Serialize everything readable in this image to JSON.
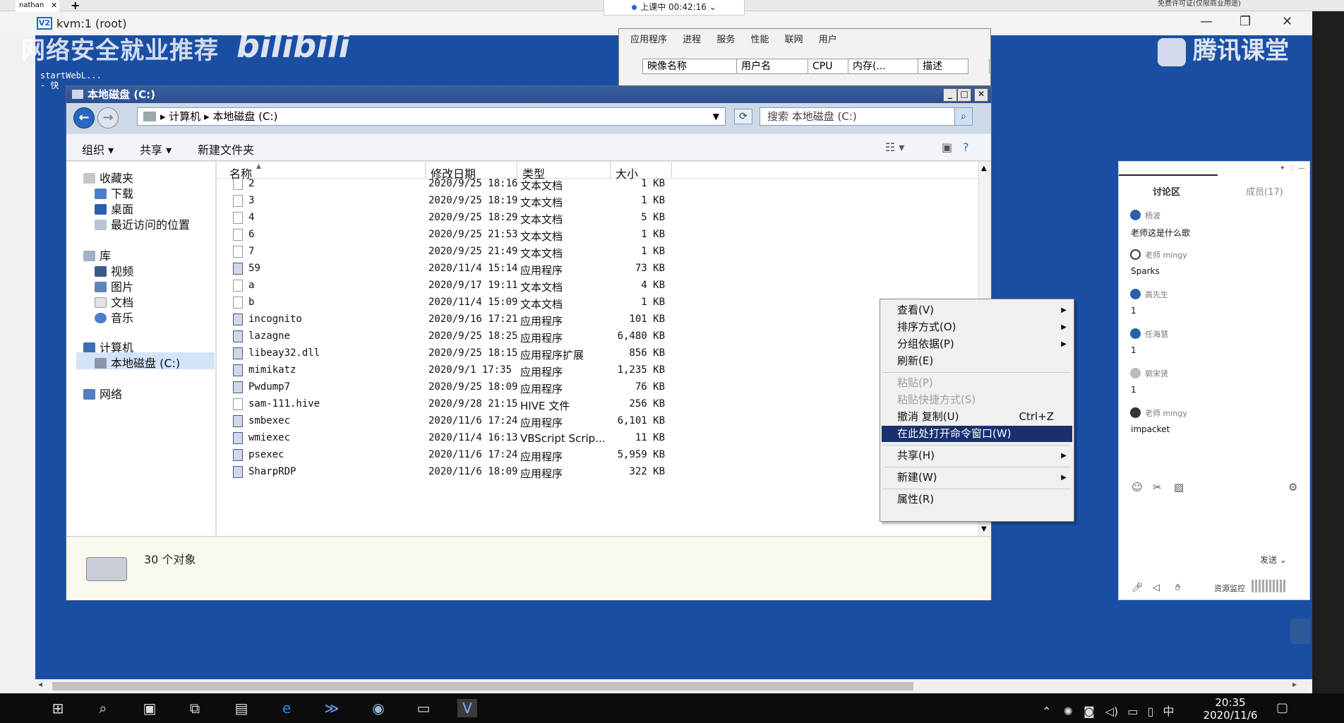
{
  "browser": {
    "tab_label": "nathan",
    "top_notice": "免费许可证(仅限商业用途)"
  },
  "classroom": {
    "status": "上课中 00:42:16",
    "status_chevron": "⌄"
  },
  "vm": {
    "title": "kvm:1 (root)",
    "icon_text": "V2"
  },
  "watermarks": {
    "left": "网络安全就业推荐",
    "bilibili": "bilibili",
    "right": "腾讯课堂"
  },
  "desktop_text": [
    "startWebL...",
    "- 快"
  ],
  "task_manager": {
    "tabs": [
      "应用程序",
      "进程",
      "服务",
      "性能",
      "联网",
      "用户"
    ],
    "columns": [
      "映像名称",
      "用户名",
      "CPU",
      "内存(...",
      "描述"
    ]
  },
  "explorer": {
    "title": "本地磁盘 (C:)",
    "breadcrumb": "▸ 计算机 ▸ 本地磁盘 (C:)",
    "search_placeholder": "搜索 本地磁盘 (C:)",
    "toolbar": {
      "organize": "组织",
      "share": "共享",
      "new_folder": "新建文件夹"
    },
    "sidebar": {
      "favorites": "收藏夹",
      "downloads": "下载",
      "desktop": "桌面",
      "recent": "最近访问的位置",
      "libraries": "库",
      "videos": "视频",
      "pictures": "图片",
      "documents": "文档",
      "music": "音乐",
      "computer": "计算机",
      "local_disk": "本地磁盘 (C:)",
      "network": "网络"
    },
    "columns": {
      "name": "名称",
      "date": "修改日期",
      "type": "类型",
      "size": "大小"
    },
    "files": [
      {
        "name": "2",
        "date": "2020/9/25 18:16",
        "type": "文本文档",
        "size": "1 KB",
        "kind": "txt"
      },
      {
        "name": "3",
        "date": "2020/9/25 18:19",
        "type": "文本文档",
        "size": "1 KB",
        "kind": "txt"
      },
      {
        "name": "4",
        "date": "2020/9/25 18:29",
        "type": "文本文档",
        "size": "5 KB",
        "kind": "txt"
      },
      {
        "name": "6",
        "date": "2020/9/25 21:53",
        "type": "文本文档",
        "size": "1 KB",
        "kind": "txt"
      },
      {
        "name": "7",
        "date": "2020/9/25 21:49",
        "type": "文本文档",
        "size": "1 KB",
        "kind": "txt"
      },
      {
        "name": "59",
        "date": "2020/11/4 15:14",
        "type": "应用程序",
        "size": "73 KB",
        "kind": "exe"
      },
      {
        "name": "a",
        "date": "2020/9/17 19:11",
        "type": "文本文档",
        "size": "4 KB",
        "kind": "txt"
      },
      {
        "name": "b",
        "date": "2020/11/4 15:09",
        "type": "文本文档",
        "size": "1 KB",
        "kind": "txt"
      },
      {
        "name": "incognito",
        "date": "2020/9/16 17:21",
        "type": "应用程序",
        "size": "101 KB",
        "kind": "exe"
      },
      {
        "name": "lazagne",
        "date": "2020/9/25 18:25",
        "type": "应用程序",
        "size": "6,480 KB",
        "kind": "exe"
      },
      {
        "name": "libeay32.dll",
        "date": "2020/9/25 18:15",
        "type": "应用程序扩展",
        "size": "856 KB",
        "kind": "dll"
      },
      {
        "name": "mimikatz",
        "date": "2020/9/1 17:35",
        "type": "应用程序",
        "size": "1,235 KB",
        "kind": "exe"
      },
      {
        "name": "Pwdump7",
        "date": "2020/9/25 18:09",
        "type": "应用程序",
        "size": "76 KB",
        "kind": "exe"
      },
      {
        "name": "sam-111.hive",
        "date": "2020/9/28 21:15",
        "type": "HIVE 文件",
        "size": "256 KB",
        "kind": "txt"
      },
      {
        "name": "smbexec",
        "date": "2020/11/6 17:24",
        "type": "应用程序",
        "size": "6,101 KB",
        "kind": "exe"
      },
      {
        "name": "wmiexec",
        "date": "2020/11/4 16:13",
        "type": "VBScript Scrip...",
        "size": "11 KB",
        "kind": "exe"
      },
      {
        "name": "psexec",
        "date": "2020/11/6 17:24",
        "type": "应用程序",
        "size": "5,959 KB",
        "kind": "exe"
      },
      {
        "name": "SharpRDP",
        "date": "2020/11/6 18:09",
        "type": "应用程序",
        "size": "322 KB",
        "kind": "exe"
      }
    ],
    "status": "30 个对象"
  },
  "context_menu": {
    "items": [
      {
        "label": "查看(V)",
        "submenu": true
      },
      {
        "label": "排序方式(O)",
        "submenu": true
      },
      {
        "label": "分组依据(P)",
        "submenu": true
      },
      {
        "label": "刷新(E)"
      },
      {
        "sep": true
      },
      {
        "label": "粘贴(P)",
        "disabled": true
      },
      {
        "label": "粘贴快捷方式(S)",
        "disabled": true
      },
      {
        "label": "撤消 复制(U)",
        "shortcut": "Ctrl+Z"
      },
      {
        "label": "在此处打开命令窗口(W)",
        "highlighted": true
      },
      {
        "sep": true
      },
      {
        "label": "共享(H)",
        "submenu": true
      },
      {
        "sep": true
      },
      {
        "label": "新建(W)",
        "submenu": true
      },
      {
        "sep": true
      },
      {
        "label": "属性(R)"
      }
    ]
  },
  "discussion": {
    "tab_discussion": "讨论区",
    "tab_members": "成员(17)",
    "messages": [
      {
        "user": "杨波",
        "text": "老师这是什么歌"
      },
      {
        "user": "老师 mingy",
        "text": "Sparks"
      },
      {
        "user": "高先生",
        "text": "1"
      },
      {
        "user": "任海慧",
        "text": "1"
      },
      {
        "user": "郭宋贤",
        "text": "1"
      },
      {
        "user": "老师 mingy",
        "text": "impacket"
      }
    ],
    "send": "发送",
    "monitor": "资源监控"
  },
  "taskbar": {
    "time": "20:35",
    "date": "2020/11/6",
    "ime": "中"
  }
}
